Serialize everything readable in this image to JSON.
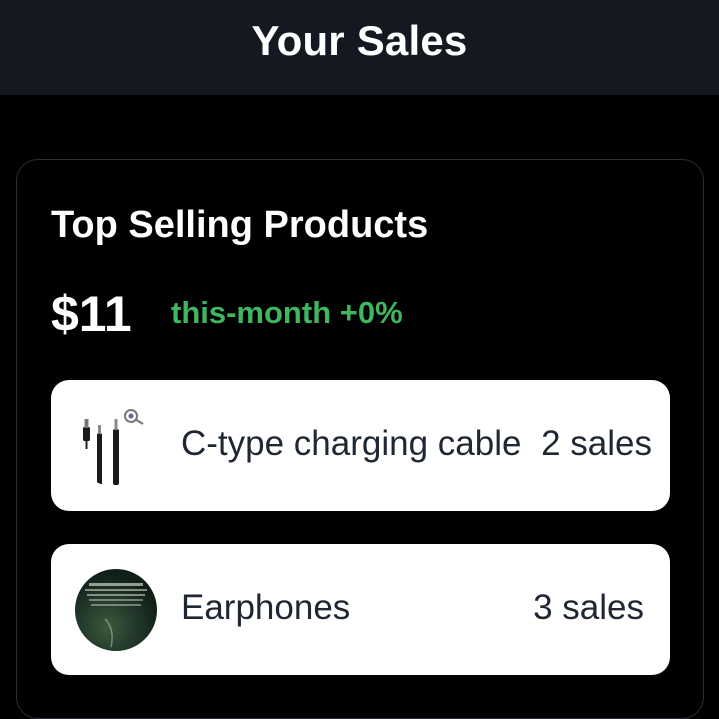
{
  "header": {
    "title": "Your Sales"
  },
  "card": {
    "title": "Top Selling Products",
    "total": "$11",
    "trend": "this-month +0%",
    "trend_color": "#3fb75f"
  },
  "products": [
    {
      "name": "C-type charging cable",
      "sales": "2 sales",
      "thumbnail": "usb-c-cable-image"
    },
    {
      "name": "Earphones",
      "sales": "3 sales",
      "thumbnail": "earphones-photo-image"
    }
  ],
  "colors": {
    "background": "#000000",
    "header_background": "#141820",
    "card_border": "#2b2f38",
    "row_background": "#ffffff",
    "row_text": "#1f2733"
  }
}
